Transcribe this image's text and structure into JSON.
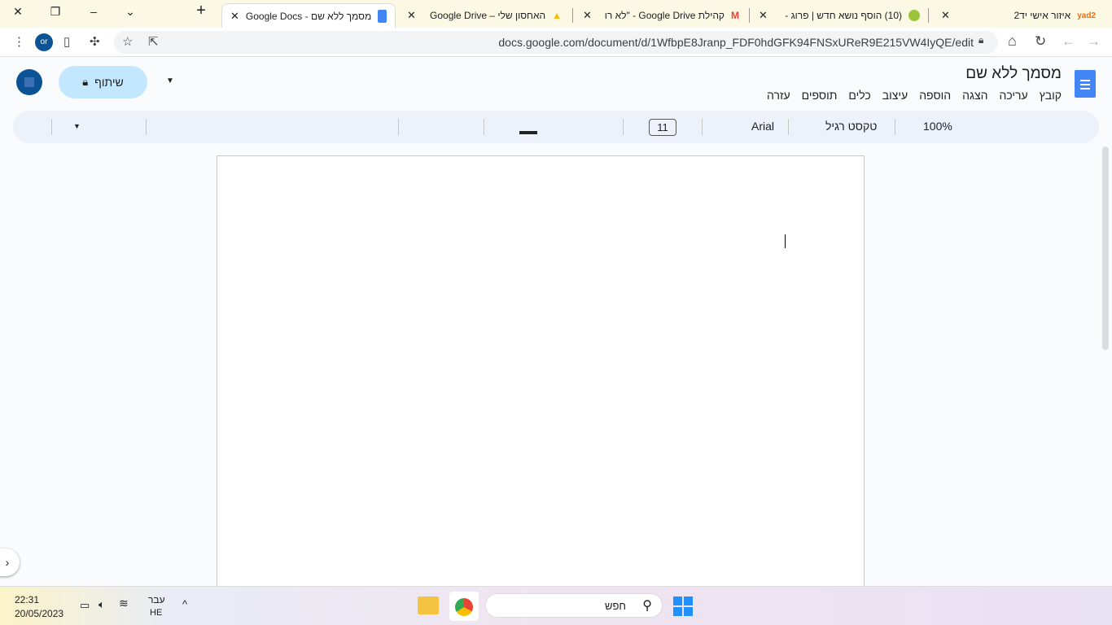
{
  "browser": {
    "tabs": [
      {
        "label": "מסמך ללא שם - Google Docs",
        "active": true
      },
      {
        "label": "האחסון שלי – Google Drive"
      },
      {
        "label": "קהילת Google Drive - \"לא רו"
      },
      {
        "label": "(10) הוסף נושא חדש | פרוג -"
      },
      {
        "label": "איזור אישי יד2"
      }
    ],
    "new_tab": "+",
    "close_glyph": "✕",
    "url": "docs.google.com/document/d/1WfbpE8Jranp_FDF0hdGFK94FNSxUReR9E215VW4IyQE/edit",
    "profile": "or"
  },
  "doc": {
    "title": "מסמך ללא שם",
    "menu": [
      "קובץ",
      "עריכה",
      "הצגה",
      "הוספה",
      "עיצוב",
      "כלים",
      "תוספים",
      "עזרה"
    ],
    "share_label": "שיתוף",
    "toolbar": {
      "zoom": "100%",
      "style": "טקסט רגיל",
      "font": "Arial",
      "font_size": "11"
    }
  },
  "taskbar": {
    "search_placeholder": "חפש",
    "time": "22:31",
    "date": "20/05/2023",
    "lang_top": "עבר",
    "lang_bottom": "HE"
  }
}
